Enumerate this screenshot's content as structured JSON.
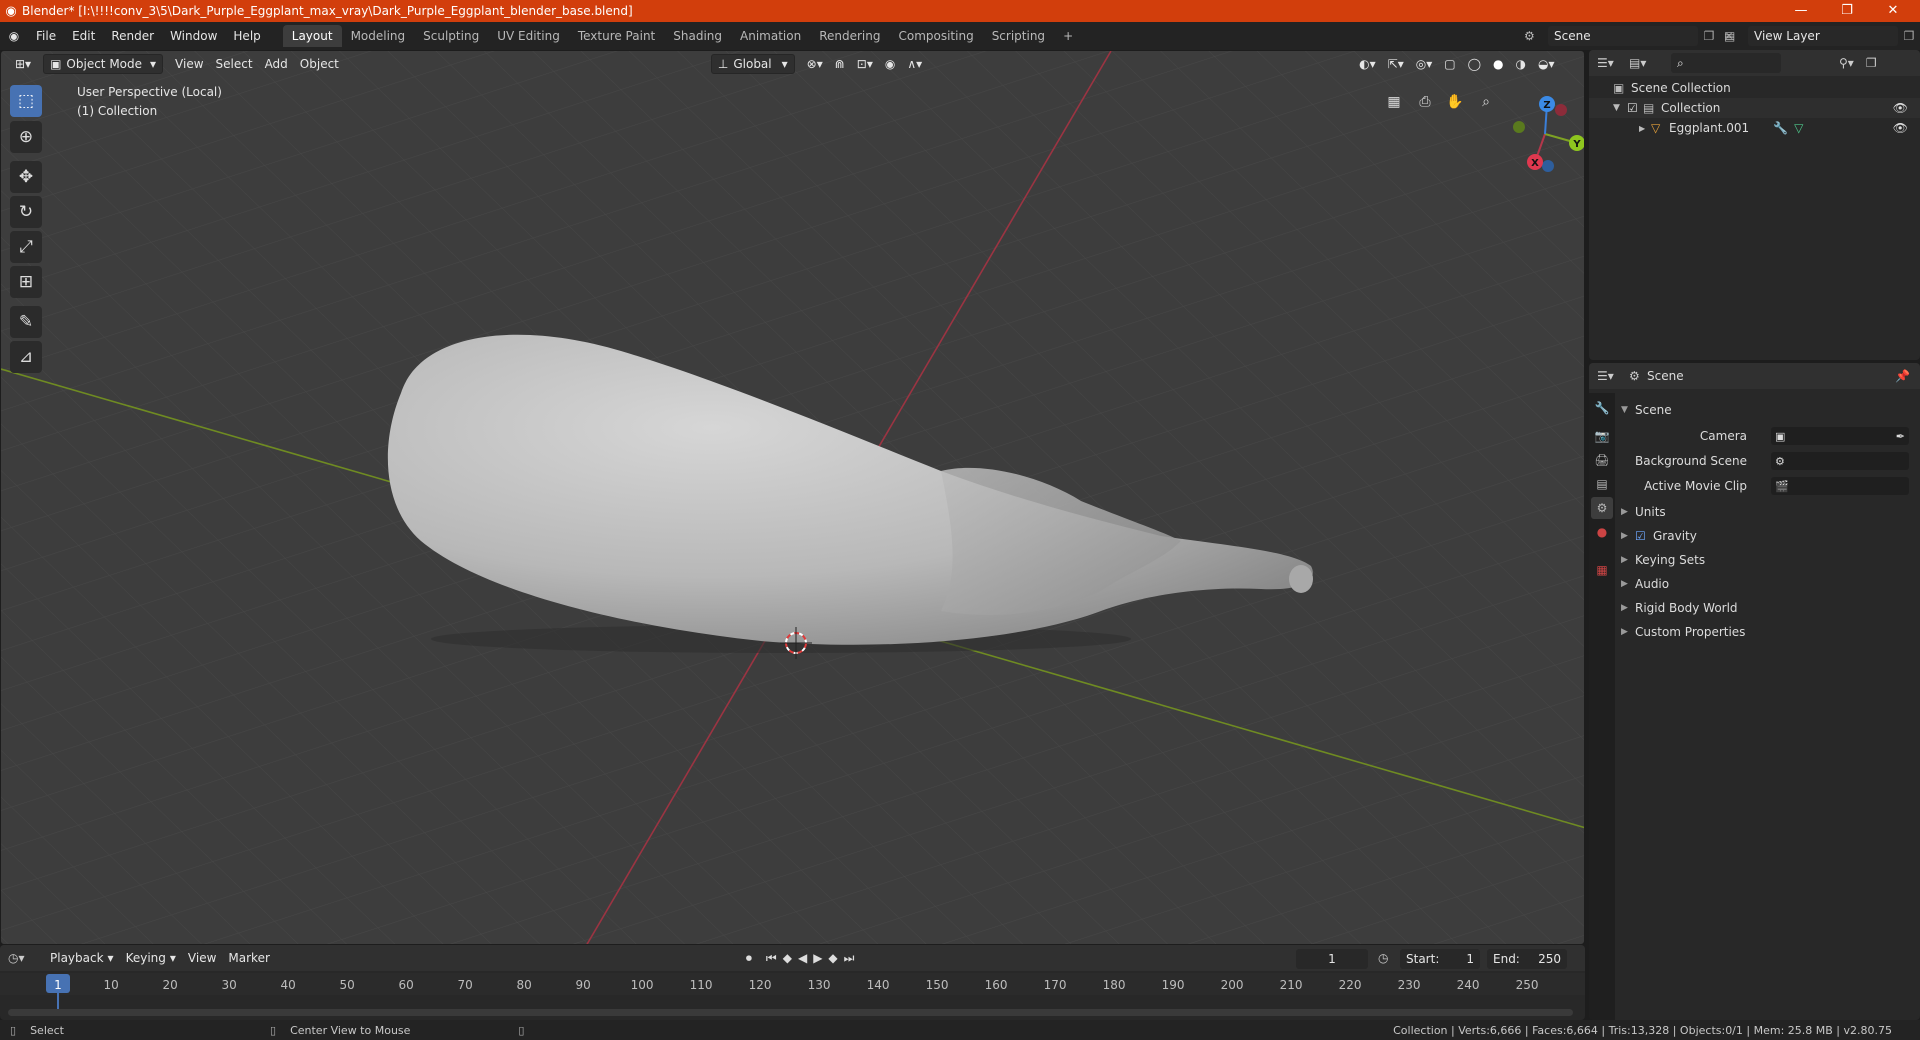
{
  "window": {
    "title": "Blender* [I:\\!!!!conv_3\\5\\Dark_Purple_Eggplant_max_vray\\Dark_Purple_Eggplant_blender_base.blend]",
    "minimize": "—",
    "restore": "❐",
    "close": "✕"
  },
  "menus": [
    "File",
    "Edit",
    "Render",
    "Window",
    "Help"
  ],
  "workspaces": [
    "Layout",
    "Modeling",
    "Sculpting",
    "UV Editing",
    "Texture Paint",
    "Shading",
    "Animation",
    "Rendering",
    "Compositing",
    "Scripting"
  ],
  "active_workspace": "Layout",
  "add_workspace": "+",
  "scene_field": "Scene",
  "view_layer_field": "View Layer",
  "viewport": {
    "mode": "Object Mode",
    "menus": [
      "View",
      "Select",
      "Add",
      "Object"
    ],
    "orientation": "Global",
    "overlay_line1": "User Perspective (Local)",
    "overlay_line2": "(1) Collection",
    "gizmo": {
      "x": "X",
      "y": "Y",
      "z": "Z"
    }
  },
  "outliner": {
    "root": "Scene Collection",
    "collection": "Collection",
    "object": "Eggplant.001"
  },
  "properties": {
    "header": "Scene",
    "panel_title": "Scene",
    "fields": [
      {
        "label": "Camera",
        "value": ""
      },
      {
        "label": "Background Scene",
        "value": ""
      },
      {
        "label": "Active Movie Clip",
        "value": ""
      }
    ],
    "sections": [
      "Units",
      "Gravity",
      "Keying Sets",
      "Audio",
      "Rigid Body World",
      "Custom Properties"
    ],
    "gravity_checked": true
  },
  "timeline": {
    "menus": [
      "Playback",
      "Keying",
      "View",
      "Marker"
    ],
    "current_frame": "1",
    "start_label": "Start:",
    "start": "1",
    "end_label": "End:",
    "end": "250",
    "ticks": [
      "1",
      "10",
      "20",
      "30",
      "40",
      "50",
      "60",
      "70",
      "80",
      "90",
      "100",
      "110",
      "120",
      "130",
      "140",
      "150",
      "160",
      "170",
      "180",
      "190",
      "200",
      "210",
      "220",
      "230",
      "240",
      "250"
    ]
  },
  "statusbar": {
    "left_action": "Select",
    "middle_action": "Center View to Mouse",
    "stats": "Collection | Verts:6,666 | Faces:6,664 | Tris:13,328 | Objects:0/1 | Mem: 25.8 MB | v2.80.75"
  },
  "colors": {
    "titlebar": "#d23e0c",
    "accent": "#4772b3",
    "x_axis": "#b3374a",
    "y_axis": "#7ea224",
    "z_axis": "#3b7fd8"
  }
}
